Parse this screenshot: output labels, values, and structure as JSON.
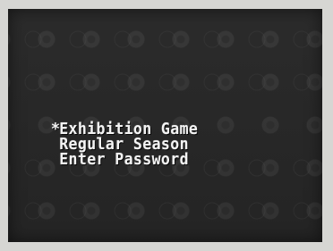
{
  "menu": {
    "cursor": "*",
    "items": [
      {
        "label": "Exhibition Game",
        "selected": true
      },
      {
        "label": "Regular Season",
        "selected": false
      },
      {
        "label": "Enter Password",
        "selected": false
      }
    ]
  },
  "colors": {
    "screen_background": "#262626",
    "menu_text": "#f4f4f4",
    "frame_background": "#d6d6d3"
  }
}
